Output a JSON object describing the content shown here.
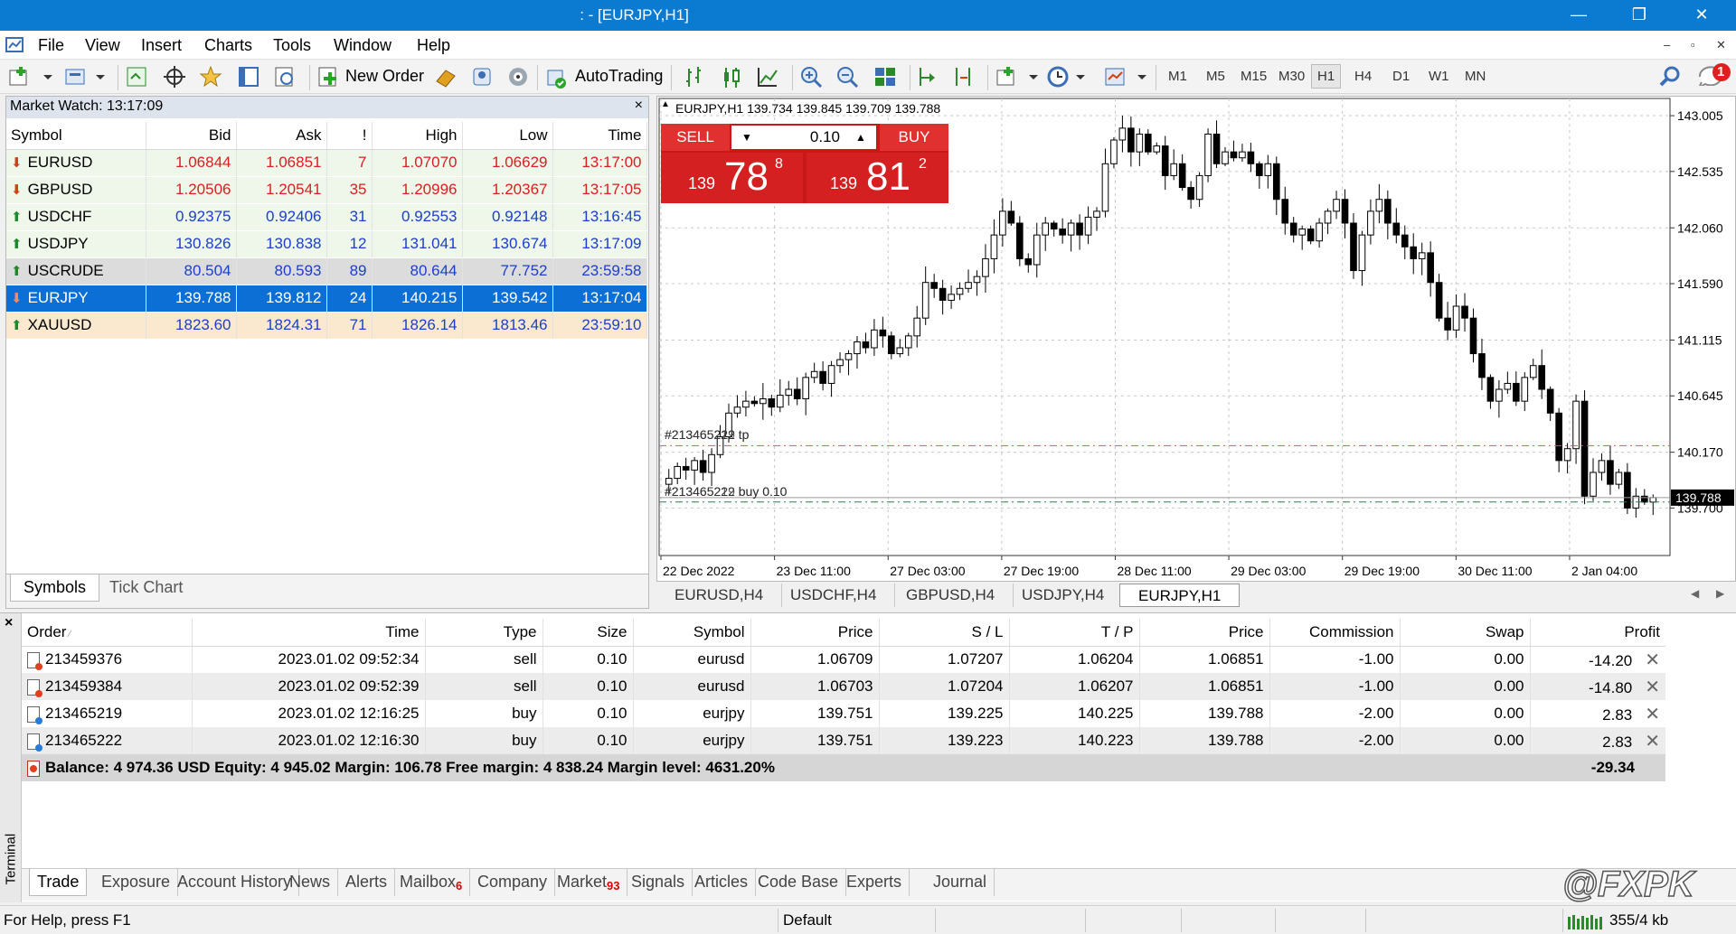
{
  "window": {
    "title": ": - [EURJPY,H1]",
    "min": "—",
    "restore": "❐",
    "close": "✕"
  },
  "menu": [
    "File",
    "View",
    "Insert",
    "Charts",
    "Tools",
    "Window",
    "Help"
  ],
  "mdi": {
    "min": "–",
    "restore": "▫",
    "close": "✕"
  },
  "toolbar": {
    "new_order": "New Order",
    "autotrading": "AutoTrading",
    "notify_count": "1",
    "timeframes": [
      "M1",
      "M5",
      "M15",
      "M30",
      "H1",
      "H4",
      "D1",
      "W1",
      "MN"
    ],
    "active_timeframe": "H1"
  },
  "market_watch": {
    "title": "Market Watch: 13:17:09",
    "close": "×",
    "columns": [
      "Symbol",
      "Bid",
      "Ask",
      "!",
      "High",
      "Low",
      "Time"
    ],
    "rows": [
      {
        "symbol": "EURUSD",
        "dir": "down",
        "bid": "1.06844",
        "ask": "1.06851",
        "spread": "7",
        "high": "1.07070",
        "low": "1.06629",
        "time": "13:17:00",
        "color": "#d82020",
        "bg": "#eef7ea"
      },
      {
        "symbol": "GBPUSD",
        "dir": "down",
        "bid": "1.20506",
        "ask": "1.20541",
        "spread": "35",
        "high": "1.20996",
        "low": "1.20367",
        "time": "13:17:05",
        "color": "#d82020",
        "bg": "#eef7ea"
      },
      {
        "symbol": "USDCHF",
        "dir": "up",
        "bid": "0.92375",
        "ask": "0.92406",
        "spread": "31",
        "high": "0.92553",
        "low": "0.92148",
        "time": "13:16:45",
        "color": "#1b3fc8",
        "bg": "#eef7ea"
      },
      {
        "symbol": "USDJPY",
        "dir": "up",
        "bid": "130.826",
        "ask": "130.838",
        "spread": "12",
        "high": "131.041",
        "low": "130.674",
        "time": "13:17:09",
        "color": "#1b3fc8",
        "bg": "#eef7ea"
      },
      {
        "symbol": "USCRUDE",
        "dir": "up",
        "bid": "80.504",
        "ask": "80.593",
        "spread": "89",
        "high": "80.644",
        "low": "77.752",
        "time": "23:59:58",
        "color": "#1b3fc8",
        "bg": "#dcdcdc"
      },
      {
        "symbol": "EURJPY",
        "dir": "down",
        "bid": "139.788",
        "ask": "139.812",
        "spread": "24",
        "high": "140.215",
        "low": "139.542",
        "time": "13:17:04",
        "color": "#ffffff",
        "bg": "#0b6fd6"
      },
      {
        "symbol": "XAUUSD",
        "dir": "up",
        "bid": "1823.60",
        "ask": "1824.31",
        "spread": "71",
        "high": "1826.14",
        "low": "1813.46",
        "time": "23:59:10",
        "color": "#1b3fc8",
        "bg": "#fbe9cf"
      }
    ],
    "tabs": [
      "Symbols",
      "Tick Chart"
    ]
  },
  "chart": {
    "header": "EURJPY,H1  139.734 139.845 139.709 139.788",
    "sell_label": "SELL",
    "buy_label": "BUY",
    "lot": "0.10",
    "sell_big": "78",
    "sell_small": "139",
    "sell_sup": "8",
    "buy_big": "81",
    "buy_small": "139",
    "buy_sup": "2",
    "tp_label": "#213465222 tp",
    "buy_label_line": "#213465222 buy 0.10",
    "tp_overlay": "#213465219 tp",
    "buy_overlay": "#213465219 buy 0.10",
    "current_price": "139.788",
    "colors": {
      "sell": "#d42020",
      "buy": "#d42020",
      "tp_line": "#e05a3c",
      "entry_line": "#2a7a4a"
    }
  },
  "chart_data": {
    "type": "candlestick",
    "yticks": [
      "143.005",
      "142.535",
      "142.060",
      "141.590",
      "141.115",
      "140.645",
      "140.170",
      "139.700"
    ],
    "ylim": [
      139.3,
      143.15
    ],
    "xticks": [
      "22 Dec 2022",
      "23 Dec 11:00",
      "27 Dec 03:00",
      "27 Dec 19:00",
      "28 Dec 11:00",
      "29 Dec 03:00",
      "29 Dec 19:00",
      "30 Dec 11:00",
      "2 Jan 04:00"
    ],
    "tp_level": 140.225,
    "entry_level": 139.751,
    "current": 139.788,
    "closes": [
      139.95,
      140.05,
      140.02,
      140.1,
      140.0,
      140.15,
      140.3,
      140.5,
      140.55,
      140.6,
      140.58,
      140.62,
      140.55,
      140.65,
      140.7,
      140.62,
      140.8,
      140.85,
      140.75,
      140.9,
      140.95,
      141.0,
      141.1,
      141.05,
      141.2,
      141.15,
      141.0,
      141.05,
      141.15,
      141.3,
      141.6,
      141.55,
      141.45,
      141.5,
      141.55,
      141.6,
      141.65,
      141.8,
      142.0,
      142.2,
      142.1,
      141.8,
      141.75,
      142.0,
      142.1,
      142.05,
      142.0,
      142.1,
      142.0,
      142.15,
      142.2,
      142.6,
      142.8,
      142.9,
      142.7,
      142.85,
      142.7,
      142.75,
      142.5,
      142.6,
      142.4,
      142.3,
      142.5,
      142.85,
      142.6,
      142.7,
      142.65,
      142.7,
      142.6,
      142.5,
      142.6,
      142.3,
      142.1,
      142.0,
      142.05,
      141.95,
      142.1,
      142.2,
      142.3,
      142.1,
      141.7,
      142.0,
      142.2,
      142.3,
      142.1,
      142.0,
      141.9,
      141.8,
      141.85,
      141.6,
      141.3,
      141.2,
      141.4,
      141.3,
      141.0,
      140.8,
      140.6,
      140.7,
      140.75,
      140.6,
      140.8,
      140.9,
      140.7,
      140.5,
      140.1,
      140.2,
      140.6,
      139.8,
      140.0,
      140.1,
      139.9,
      140.0,
      139.7,
      139.8,
      139.75,
      139.788
    ]
  },
  "chart_tabs": [
    "EURUSD,H4",
    "USDCHF,H4",
    "GBPUSD,H4",
    "USDJPY,H4",
    "EURJPY,H1"
  ],
  "terminal": {
    "side_label": "Terminal",
    "close": "×",
    "columns": [
      "Order",
      "Time",
      "Type",
      "Size",
      "Symbol",
      "Price",
      "S / L",
      "T / P",
      "Price",
      "Commission",
      "Swap",
      "Profit"
    ],
    "rows": [
      {
        "order": "213459376",
        "time": "2023.01.02 09:52:34",
        "type": "sell",
        "size": "0.10",
        "symbol": "eurusd",
        "price": "1.06709",
        "sl": "1.07207",
        "tp": "1.06204",
        "cur": "1.06851",
        "comm": "-1.00",
        "swap": "0.00",
        "profit": "-14.20",
        "dot": "#e04020"
      },
      {
        "order": "213459384",
        "time": "2023.01.02 09:52:39",
        "type": "sell",
        "size": "0.10",
        "symbol": "eurusd",
        "price": "1.06703",
        "sl": "1.07204",
        "tp": "1.06207",
        "cur": "1.06851",
        "comm": "-1.00",
        "swap": "0.00",
        "profit": "-14.80",
        "dot": "#e04020"
      },
      {
        "order": "213465219",
        "time": "2023.01.02 12:16:25",
        "type": "buy",
        "size": "0.10",
        "symbol": "eurjpy",
        "price": "139.751",
        "sl": "139.225",
        "tp": "140.225",
        "cur": "139.788",
        "comm": "-2.00",
        "swap": "0.00",
        "profit": "2.83",
        "dot": "#2a7ad8"
      },
      {
        "order": "213465222",
        "time": "2023.01.02 12:16:30",
        "type": "buy",
        "size": "0.10",
        "symbol": "eurjpy",
        "price": "139.751",
        "sl": "139.223",
        "tp": "140.223",
        "cur": "139.788",
        "comm": "-2.00",
        "swap": "0.00",
        "profit": "2.83",
        "dot": "#2a7ad8"
      }
    ],
    "balance_line": "Balance: 4 974.36 USD  Equity: 4 945.02  Margin: 106.78  Free margin: 4 838.24  Margin level: 4631.20%",
    "total_profit": "-29.34",
    "tabs": [
      {
        "label": "Trade",
        "badge": ""
      },
      {
        "label": "Exposure",
        "badge": ""
      },
      {
        "label": "Account History",
        "badge": ""
      },
      {
        "label": "News",
        "badge": ""
      },
      {
        "label": "Alerts",
        "badge": ""
      },
      {
        "label": "Mailbox",
        "badge": "6"
      },
      {
        "label": "Company",
        "badge": ""
      },
      {
        "label": "Market",
        "badge": "93"
      },
      {
        "label": "Signals",
        "badge": ""
      },
      {
        "label": "Articles",
        "badge": ""
      },
      {
        "label": "Code Base",
        "badge": ""
      },
      {
        "label": "Experts",
        "badge": ""
      },
      {
        "label": "Journal",
        "badge": ""
      }
    ],
    "watermark": "@FXPK"
  },
  "status": {
    "help": "For Help, press F1",
    "profile": "Default",
    "traffic": "355/4 kb"
  }
}
